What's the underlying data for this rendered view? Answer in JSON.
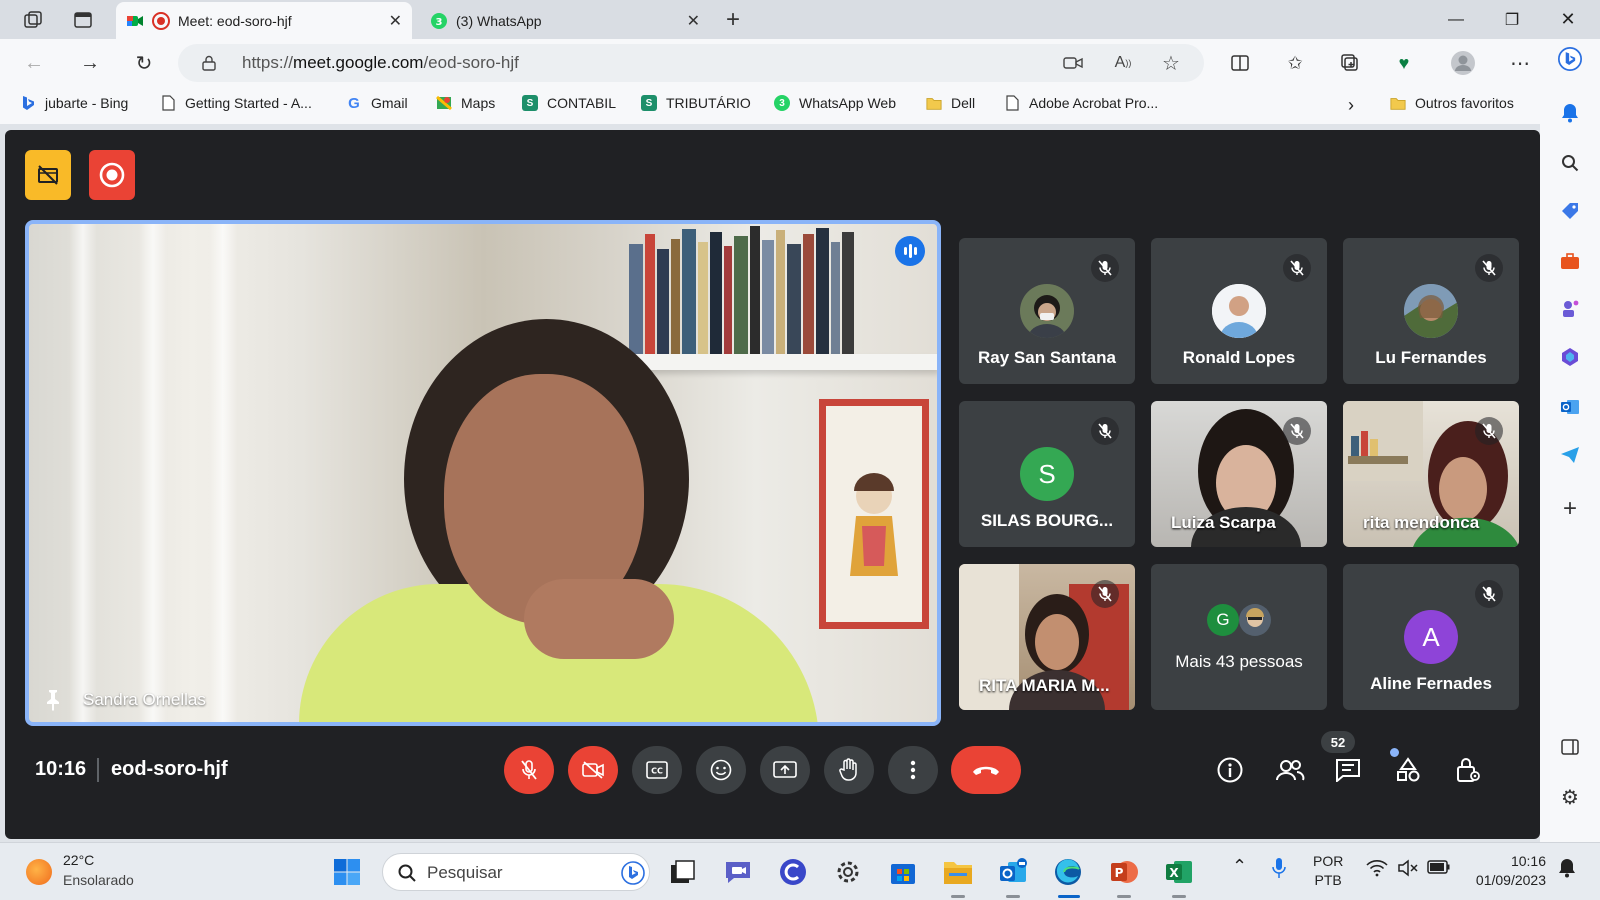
{
  "browser": {
    "tabs": [
      {
        "title": "Meet: eod-soro-hjf",
        "active": true
      },
      {
        "title": "(3) WhatsApp",
        "active": false,
        "badge": "3"
      }
    ],
    "url_prefix": "https://",
    "url_host": "meet.google.com",
    "url_path": "/eod-soro-hjf"
  },
  "bookmarks": [
    {
      "label": "jubarte - Bing",
      "icon": "bing-icon",
      "color": "#2b6fe0"
    },
    {
      "label": "Getting Started - A...",
      "icon": "page-icon",
      "color": "#ffffff"
    },
    {
      "label": "Gmail",
      "icon": "google-icon",
      "color": "#ffffff"
    },
    {
      "label": "Maps",
      "icon": "maps-icon",
      "color": "#34a853"
    },
    {
      "label": "CONTABIL",
      "icon": "sheets-icon",
      "color": "#1d8f6a"
    },
    {
      "label": "TRIBUTÁRIO",
      "icon": "sheets-icon",
      "color": "#1d8f6a"
    },
    {
      "label": "WhatsApp Web",
      "icon": "whatsapp-icon",
      "color": "#25d366",
      "badge": "3"
    },
    {
      "label": "Dell",
      "icon": "folder-icon",
      "color": "#f2c94c"
    },
    {
      "label": "Adobe Acrobat Pro...",
      "icon": "page-icon",
      "color": "#ffffff"
    }
  ],
  "bookmarks_more": "Outros favoritos",
  "meet": {
    "main_participant": "Sandra Ornellas",
    "tiles": [
      {
        "name": "Ray San Santana",
        "avatar_type": "photo",
        "muted": true
      },
      {
        "name": "Ronald Lopes",
        "avatar_type": "photo",
        "muted": true
      },
      {
        "name": "Lu Fernandes",
        "avatar_type": "photo",
        "muted": true
      },
      {
        "name": "SILAS BOURG...",
        "avatar_type": "letter",
        "letter": "S",
        "avatar_color": "#34a853",
        "muted": true
      },
      {
        "name": "Luiza Scarpa",
        "avatar_type": "video",
        "muted": true
      },
      {
        "name": "rita mendonca",
        "avatar_type": "video",
        "muted": true
      },
      {
        "name": "RITA MARIA M...",
        "avatar_type": "video",
        "muted": true
      },
      {
        "name": "Mais 43 pessoas",
        "avatar_type": "group",
        "letter": "G",
        "avatar_color": "#1e8e3e",
        "muted": false
      },
      {
        "name": "Aline Fernades",
        "avatar_type": "letter",
        "letter": "A",
        "avatar_color": "#8e44d8",
        "muted": true
      }
    ],
    "time": "10:16",
    "code": "eod-soro-hjf",
    "people_count": "52"
  },
  "taskbar": {
    "temperature": "22°C",
    "weather": "Ensolarado",
    "search_placeholder": "Pesquisar",
    "lang_line1": "POR",
    "lang_line2": "PTB",
    "clock_time": "10:16",
    "clock_date": "01/09/2023"
  }
}
